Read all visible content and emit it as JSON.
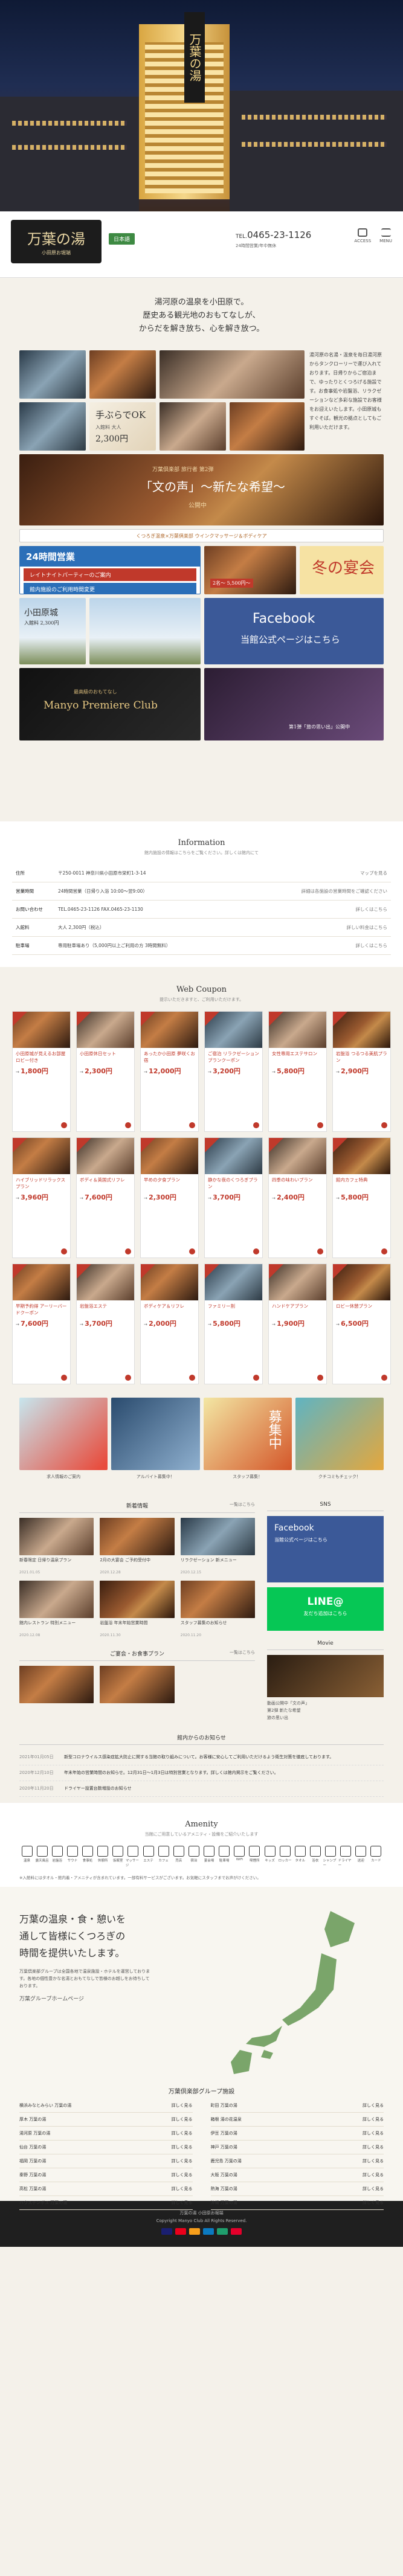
{
  "header": {
    "logo_main": "万葉の湯",
    "logo_sub": "小田原お堀端",
    "lang_button": "日本語",
    "tel_label": "TEL.",
    "tel": "0465-23-1126",
    "tel_note": "24時間営業/年中無休",
    "icons": [
      {
        "name": "access",
        "label": "ACCESS"
      },
      {
        "name": "menu",
        "label": "MENU"
      }
    ]
  },
  "hero": {
    "sign": "万葉の湯"
  },
  "intro": {
    "lines": [
      "湯河原の温泉を小田原で。",
      "歴史ある観光地のおもてなしが、",
      "からだを解き放ち、心を解き放つ。"
    ]
  },
  "mosaic": {
    "side_text": "湯河原の名湯・温泉を毎日湯河原からタンクローリーで運び入れております。日帰りからご宿泊まで、ゆったりとくつろげる施設です。お食事処や岩盤浴、リラクゼーションなど多彩な施設でお客様をお迎えいたします。小田原城もすぐそば。観光の拠点としてもご利用いただけます。",
    "tebura": {
      "title": "手ぶらでOK",
      "text": "入館料 大人",
      "price": "2,300円"
    },
    "stage": {
      "sub": "万葉倶楽部 旅行者 第2弾",
      "title": "「文の声」〜新たな希望〜",
      "tail": "公開中"
    },
    "wink_banner": "くつろぎ温泉×万葉倶楽部 ウインクマッサージ＆ボディケア",
    "b24": {
      "title": "24時間営業",
      "sub1": "レイトナイトパーティーのご案内",
      "sub2": "館内施設のご利用時間変更"
    },
    "fuyu": {
      "title": "冬の宴会",
      "price": "2名〜 5,500円〜"
    },
    "fb": {
      "title": "Facebook",
      "sub": "当館公式ページはこちら"
    },
    "castle": {
      "title": "小田原城",
      "price": "入館料 2,300円"
    },
    "manyo": {
      "sub": "最高級のおもてなし",
      "title": "Manyo Premiere Club",
      "tail": "第1弾「旅の思い出」公開中"
    }
  },
  "info": {
    "heading": "Information",
    "sub": "館内施設の情報はこちらをご覧ください。詳しくは館内にて",
    "rows": [
      {
        "k": "住所",
        "v": "〒250-0011 神奈川県小田原市栄町1-3-14",
        "l": "マップを見る"
      },
      {
        "k": "営業時間",
        "v": "24時間営業（日帰り入浴 10:00〜翌9:00）",
        "l": "詳細は各施設の営業時間をご確認ください"
      },
      {
        "k": "お問い合わせ",
        "v": "TEL.0465-23-1126  FAX.0465-23-1130",
        "l": "詳しくはこちら"
      },
      {
        "k": "入館料",
        "v": "大人 2,300円（税込）",
        "l": "詳しい料金はこちら"
      },
      {
        "k": "駐車場",
        "v": "専用駐車場あり（5,000円以上ご利用の方 3時間無料）",
        "l": "詳しくはこちら"
      }
    ]
  },
  "coupons": {
    "heading": "Web Coupon",
    "sub": "提示いただきますと、ご利用いただけます。",
    "items": [
      {
        "title": "小田原城が見えるお部屋ロビー付き",
        "price": "1,800円"
      },
      {
        "title": "小田原休日セット",
        "price": "2,300円"
      },
      {
        "title": "あったか小田原 夢咲くお宿",
        "price": "12,000円"
      },
      {
        "title": "ご宿泊 リラクゼーションプランクーポン",
        "price": "3,200円"
      },
      {
        "title": "女性専用エステサロン",
        "price": "5,800円"
      },
      {
        "title": "岩盤浴 つるつる美肌プラン",
        "price": "2,900円"
      },
      {
        "title": "ハイブリッドリラックスプラン",
        "price": "3,960円"
      },
      {
        "title": "ボディ＆英国式リフレ",
        "price": "7,600円"
      },
      {
        "title": "早めの夕食プラン",
        "price": "2,300円"
      },
      {
        "title": "静かな夜のくつろぎプラン",
        "price": "3,700円"
      },
      {
        "title": "四季の味わいプラン",
        "price": "2,400円"
      },
      {
        "title": "館内カフェ特典",
        "price": "5,800円"
      },
      {
        "title": "早期予約得 アーリーバードクーポン",
        "price": "7,600円"
      },
      {
        "title": "岩盤浴エステ",
        "price": "3,700円"
      },
      {
        "title": "ボディケア＆リフレ",
        "price": "2,000円"
      },
      {
        "title": "ファミリー割",
        "price": "5,800円"
      },
      {
        "title": "ハンドケアプラン",
        "price": "1,900円"
      },
      {
        "title": "ロビー休憩プラン",
        "price": "6,500円"
      }
    ]
  },
  "recruit": {
    "labels": [
      "求人情報のご案内",
      "アルバイト募集中！",
      "スタッフ募集！",
      "クチコミもチェック！"
    ],
    "badge": "募集中"
  },
  "news": {
    "heading": "新着情報",
    "more": "一覧はこちら",
    "items": [
      {
        "text": "新春限定 日帰り温泉プラン",
        "date": "2021.01.05"
      },
      {
        "text": "2月の大宴会 ご予約受付中",
        "date": "2020.12.28"
      },
      {
        "text": "リラクゼーション 新メニュー",
        "date": "2020.12.15"
      },
      {
        "text": "館内レストラン 特別メニュー",
        "date": "2020.12.08"
      },
      {
        "text": "岩盤浴 年末年始営業時間",
        "date": "2020.11.30"
      },
      {
        "text": "スタッフ募集のお知らせ",
        "date": "2020.11.20"
      }
    ]
  },
  "sns": {
    "heading": "SNS",
    "fb": "Facebook",
    "fb_sub": "当館公式ページはこちら",
    "line": "LINE@",
    "line_sub": "友だち追加はこちら"
  },
  "movie": {
    "heading": "Movie",
    "list": [
      "動画公開中「文の声」",
      "第2弾 新たな希望",
      "旅の思い出"
    ]
  },
  "pickup": {
    "heading": "ご宴会・お食事プラン",
    "more": "一覧はこちら"
  },
  "orgnews": {
    "heading": "館内からのお知らせ",
    "rows": [
      {
        "d": "2021年01月05日",
        "t": "新型コロナウイルス感染症拡大防止に関する当館の取り組みについて。お客様に安心してご利用いただけるよう衛生対策を徹底しております。"
      },
      {
        "d": "2020年12月10日",
        "t": "年末年始の営業時間のお知らせ。12月31日〜1月3日は特別営業となります。詳しくは館内掲示をご覧ください。"
      },
      {
        "d": "2020年11月20日",
        "t": "ドライヤー設置台数増設のお知らせ"
      }
    ]
  },
  "amenity": {
    "heading": "Amenity",
    "sub": "当館にご用意しているアメニティ・設備をご紹介いたします",
    "items": [
      "温泉",
      "露天風呂",
      "岩盤浴",
      "サウナ",
      "食事処",
      "休憩所",
      "仮眠室",
      "マッサージ",
      "エステ",
      "カフェ",
      "売店",
      "宿泊",
      "宴会場",
      "駐車場",
      "WiFi",
      "喫煙所",
      "キッズ",
      "ロッカー",
      "タオル",
      "浴衣",
      "シャンプー",
      "ドライヤー",
      "送迎",
      "カード"
    ],
    "note": "※入館料にはタオル・館内着・アメニティが含まれています。一部有料サービスがございます。お気軽にスタッフまでお声がけください。"
  },
  "group": {
    "lead": [
      "万葉の温泉・食・憩いを",
      "通して皆様にくつろぎの",
      "時間を提供いたします。"
    ],
    "desc": "万葉倶楽部グループは全国各地で温泉施設・ホテルを運営しております。各地の個性豊かな名湯とおもてなしで皆様のお越しをお待ちしております。",
    "sign": "万葉グループホームページ",
    "hotels_heading": "万葉倶楽部グループ施設",
    "hotels": [
      "横浜みなとみらい 万葉の湯",
      "町田 万葉の湯",
      "厚木 万葉の湯",
      "箱根 湯の花温泉",
      "湯河原 万葉の湯",
      "伊豆 万葉の湯",
      "仙台 万葉の湯",
      "神戸 万葉の湯",
      "福岡 万葉の湯",
      "鹿児島 万葉の湯",
      "秦野 万葉の湯",
      "大阪 万葉の湯",
      "高松 万葉の湯",
      "熱海 万葉の湯",
      "ハウステンボス 万葉の湯",
      "沖縄 万葉の湯"
    ],
    "hotel_link": "詳しく見る"
  },
  "footer": {
    "line1": "万葉の湯 小田原お堀端",
    "copy": "Copyright Manyo Club All Rights Reserved.",
    "pay_colors": [
      "#1a1f71",
      "#eb001b",
      "#f79e1b",
      "#0b7ac1",
      "#1f9e6d",
      "#e4002b"
    ]
  }
}
